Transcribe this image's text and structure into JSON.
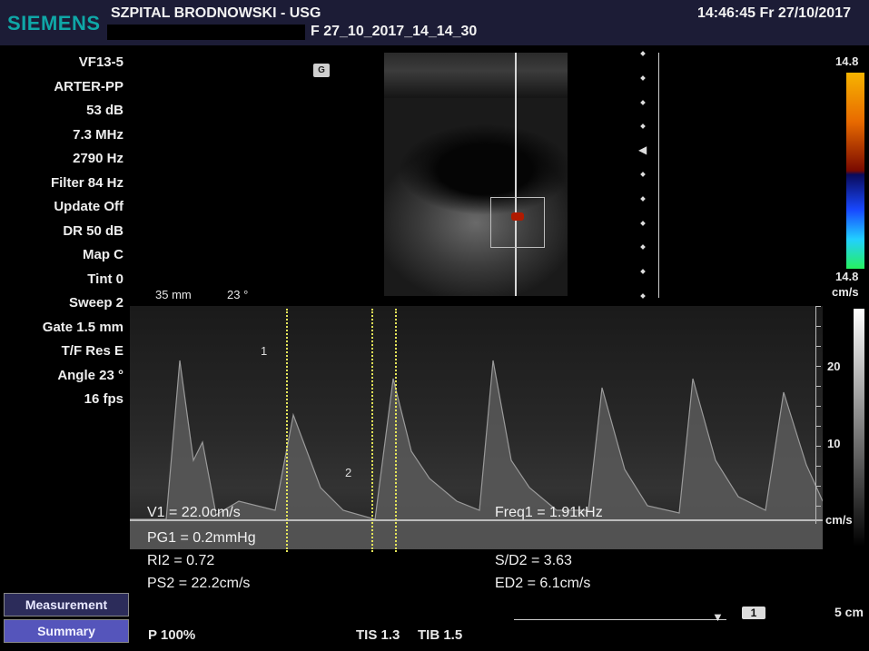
{
  "header": {
    "brand": "SIEMENS",
    "hospital": "SZPITAL BRODNOWSKI - USG",
    "study_id": "F  27_10_2017_14_14_30",
    "datetime": "14:46:45  Fr  27/10/2017"
  },
  "params": [
    "VF13-5",
    "ARTER-PP",
    "53 dB",
    "7.3 MHz",
    "2790 Hz",
    "Filter 84 Hz",
    "Update Off",
    "DR 50 dB",
    "Map C",
    "Tint 0",
    "Sweep 2",
    "Gate 1.5 mm",
    "T/F Res E",
    "Angle 23 °",
    "16 fps"
  ],
  "image_info": {
    "depth": "35 mm",
    "angle": "23 °"
  },
  "color_scale": {
    "max": "14.8",
    "min": "14.8",
    "unit": "cm/s"
  },
  "doppler_scale": {
    "labels": [
      "20",
      "10"
    ],
    "unit": "cm/s"
  },
  "markers": {
    "m1": "1",
    "m2": "2"
  },
  "measurements": {
    "v1": "V1 = 22.0cm/s",
    "freq1": "Freq1 = 1.91kHz",
    "pg1": "PG1 = 0.2mmHg",
    "ri2": "RI2 = 0.72",
    "sd2": "S/D2 = 3.63",
    "ps2": "PS2 = 22.2cm/s",
    "ed2": "ED2 = 6.1cm/s"
  },
  "buttons": {
    "measurement": "Measurement",
    "summary": "Summary"
  },
  "footer": {
    "power": "P 100%",
    "tis": "TIS 1.3",
    "tib": "TIB 1.5",
    "cine_frame": "1",
    "scale": "5 cm"
  },
  "icons": {
    "probe": "probe-orientation-icon",
    "cine": "chevron-down-icon"
  },
  "colors": {
    "header_bg": "#1c1c36",
    "brand": "#0fa7a7",
    "measure_line": "#e8e85a",
    "summary_btn": "#5555bb"
  }
}
